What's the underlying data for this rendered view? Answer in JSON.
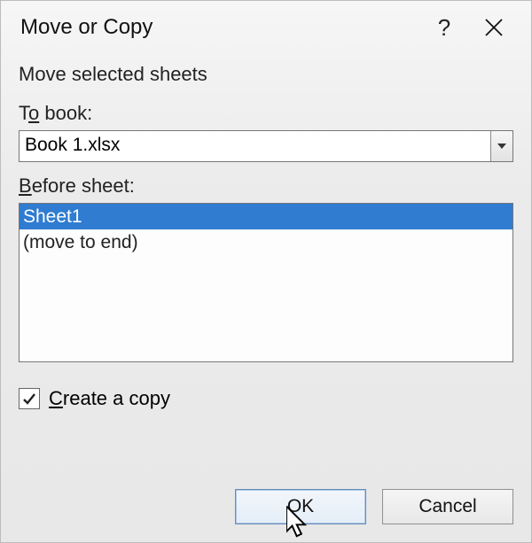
{
  "titlebar": {
    "title": "Move or Copy",
    "help": "?",
    "close": "✕"
  },
  "body": {
    "heading": "Move selected sheets",
    "to_book_label_pre": "T",
    "to_book_label_u": "o",
    "to_book_label_post": " book:",
    "to_book_value": "Book 1.xlsx",
    "before_sheet_label_pre": "",
    "before_sheet_label_u": "B",
    "before_sheet_label_post": "efore sheet:",
    "sheet_items": [
      "Sheet1",
      "(move to end)"
    ],
    "create_copy_pre": "",
    "create_copy_u": "C",
    "create_copy_post": "reate a copy",
    "create_copy_checked": true
  },
  "buttons": {
    "ok": "OK",
    "cancel": "Cancel"
  }
}
